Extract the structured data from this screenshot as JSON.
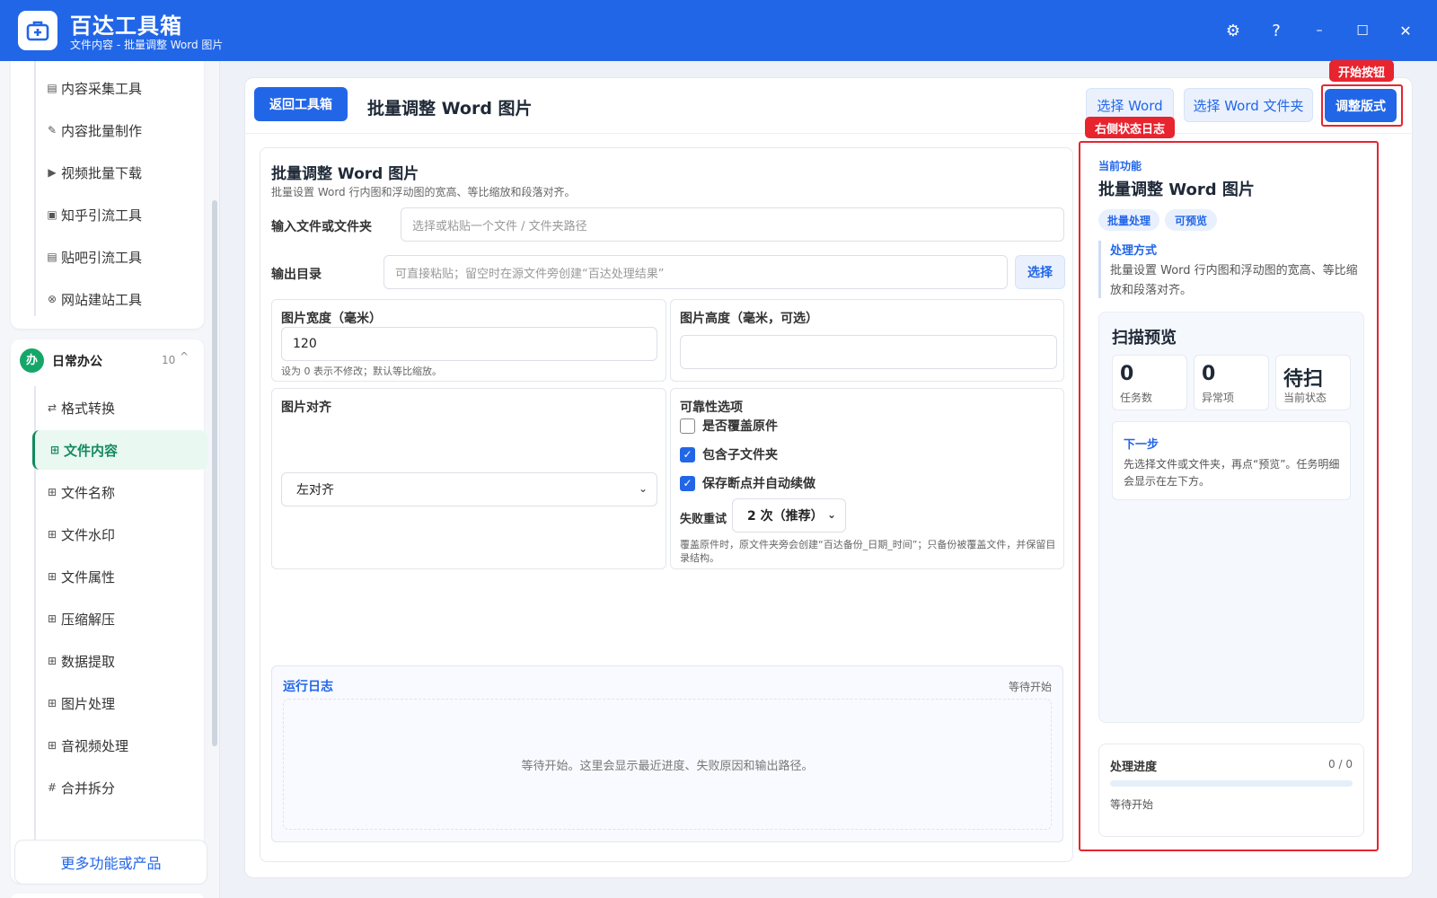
{
  "app": {
    "title": "百达工具箱",
    "subtitle": "文件内容 - 批量调整 Word 图片"
  },
  "window_controls": {
    "settings": "⚙",
    "help": "?",
    "minimize": "–",
    "maximize": "☐",
    "close": "✕"
  },
  "sidebar": {
    "top_items": [
      {
        "label": "内容采集工具",
        "icon": "▤"
      },
      {
        "label": "内容批量制作",
        "icon": "✎"
      },
      {
        "label": "视频批量下载",
        "icon": "▶"
      },
      {
        "label": "知乎引流工具",
        "icon": "▣"
      },
      {
        "label": "贴吧引流工具",
        "icon": "▤"
      },
      {
        "label": "网站建站工具",
        "icon": "⊗"
      }
    ],
    "group": {
      "badge": "办",
      "title": "日常办公",
      "count": "10",
      "caret": "^"
    },
    "group_items": [
      {
        "label": "格式转换",
        "icon": "⇄"
      },
      {
        "label": "文件内容",
        "icon": "⊞"
      },
      {
        "label": "文件名称",
        "icon": "⊞"
      },
      {
        "label": "文件水印",
        "icon": "⊞"
      },
      {
        "label": "文件属性",
        "icon": "⊞"
      },
      {
        "label": "压缩解压",
        "icon": "⊞"
      },
      {
        "label": "数据提取",
        "icon": "⊞"
      },
      {
        "label": "图片处理",
        "icon": "⊞"
      },
      {
        "label": "音视频处理",
        "icon": "⊞"
      },
      {
        "label": "合并拆分",
        "icon": "#"
      }
    ],
    "active_item": "文件内容",
    "more_button": "更多功能或产品"
  },
  "toolbar": {
    "back_button": "返回工具箱",
    "page_title": "批量调整 Word 图片",
    "select_word": "选择 Word",
    "select_folder": "选择 Word 文件夹",
    "run_button": "调整版式"
  },
  "annotations": {
    "start": "开始按钮",
    "log": "右侧状态日志"
  },
  "form": {
    "title": "批量调整 Word 图片",
    "description": "批量设置 Word 行内图和浮动图的宽高、等比缩放和段落对齐。",
    "input_label": "输入文件或文件夹",
    "input_placeholder": "选择或粘贴一个文件 / 文件夹路径",
    "output_label": "输出目录",
    "output_placeholder": "可直接粘贴；留空时在源文件旁创建“百达处理结果”",
    "output_select": "选择",
    "width_label": "图片宽度（毫米）",
    "width_value": "120",
    "width_hint": "设为 0 表示不修改；默认等比缩放。",
    "height_label": "图片高度（毫米，可选）",
    "height_value": "",
    "align_label": "图片对齐",
    "align_value": "左对齐",
    "reliability_label": "可靠性选项",
    "options": [
      {
        "label": "是否覆盖原件",
        "checked": false
      },
      {
        "label": "包含子文件夹",
        "checked": true
      },
      {
        "label": "保存断点并自动续做",
        "checked": true
      }
    ],
    "retry_label": "失败重试",
    "retry_value": "2 次（推荐）",
    "backup_hint": "覆盖原件时，原文件夹旁会创建“百达备份_日期_时间”；只备份被覆盖文件，并保留目录结构。"
  },
  "log": {
    "title": "运行日志",
    "status": "等待开始",
    "placeholder": "等待开始。这里会显示最近进度、失败原因和输出路径。"
  },
  "right_panel": {
    "current_label": "当前功能",
    "title": "批量调整 Word 图片",
    "tags": [
      "批量处理",
      "可预览"
    ],
    "method_title": "处理方式",
    "method_desc": "批量设置 Word 行内图和浮动图的宽高、等比缩放和段落对齐。",
    "scan_title": "扫描预览",
    "stats": [
      {
        "value": "0",
        "label": "任务数"
      },
      {
        "value": "0",
        "label": "异常项"
      },
      {
        "value": "待扫",
        "label": "当前状态"
      }
    ],
    "next_title": "下一步",
    "next_desc": "先选择文件或文件夹，再点“预览”。任务明细会显示在左下方。",
    "progress_title": "处理进度",
    "progress_count": "0 / 0",
    "progress_fraction": 0,
    "progress_status": "等待开始"
  },
  "colors": {
    "primary": "#2266e8",
    "green": "#15a66a",
    "annotation": "#e8242f"
  }
}
